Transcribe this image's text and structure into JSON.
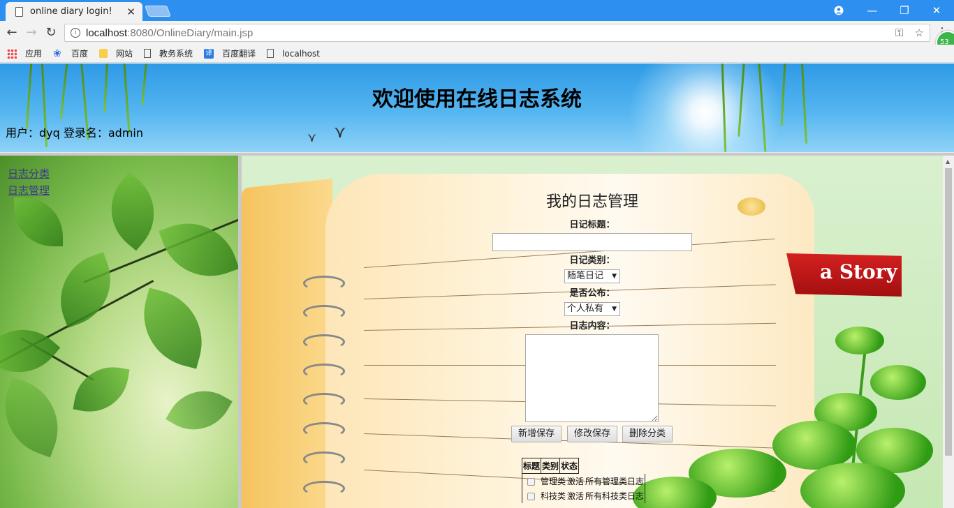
{
  "browser": {
    "tab_title": "online diary login!",
    "url_host": "localhost",
    "url_path": ":8080/OnlineDiary/main.jsp",
    "extension_badge": "53",
    "bookmarks": [
      {
        "label": "应用",
        "icon": "apps-grid-icon"
      },
      {
        "label": "百度",
        "icon": "baidu-paw-icon"
      },
      {
        "label": "网站",
        "icon": "folder-icon"
      },
      {
        "label": "教务系统",
        "icon": "page-icon"
      },
      {
        "label": "百度翻译",
        "icon": "translate-icon"
      },
      {
        "label": "localhost",
        "icon": "page-icon"
      }
    ]
  },
  "header": {
    "title": "欢迎使用在线日志系统",
    "user_line": "用户：dyq 登录名：admin"
  },
  "leftnav": {
    "items": [
      "日志分类",
      "日志管理"
    ]
  },
  "main": {
    "title": "我的日志管理",
    "label_title": "日记标题：",
    "title_value": "",
    "label_category": "日记类别：",
    "category_value": "随笔日记",
    "label_public": "是否公布：",
    "public_value": "个人私有",
    "label_content": "日志内容：",
    "content_value": "",
    "buttons": {
      "add": "新增保存",
      "edit": "修改保存",
      "delete": "删除分类"
    },
    "ribbon_text": "a Story",
    "table": {
      "headers": [
        "标题",
        "类别",
        "状态"
      ],
      "rows": [
        {
          "title": "管理类",
          "category": "激活",
          "status": "所有管理类日志"
        },
        {
          "title": "科技类",
          "category": "激活",
          "status": "所有科技类日志"
        }
      ]
    }
  }
}
